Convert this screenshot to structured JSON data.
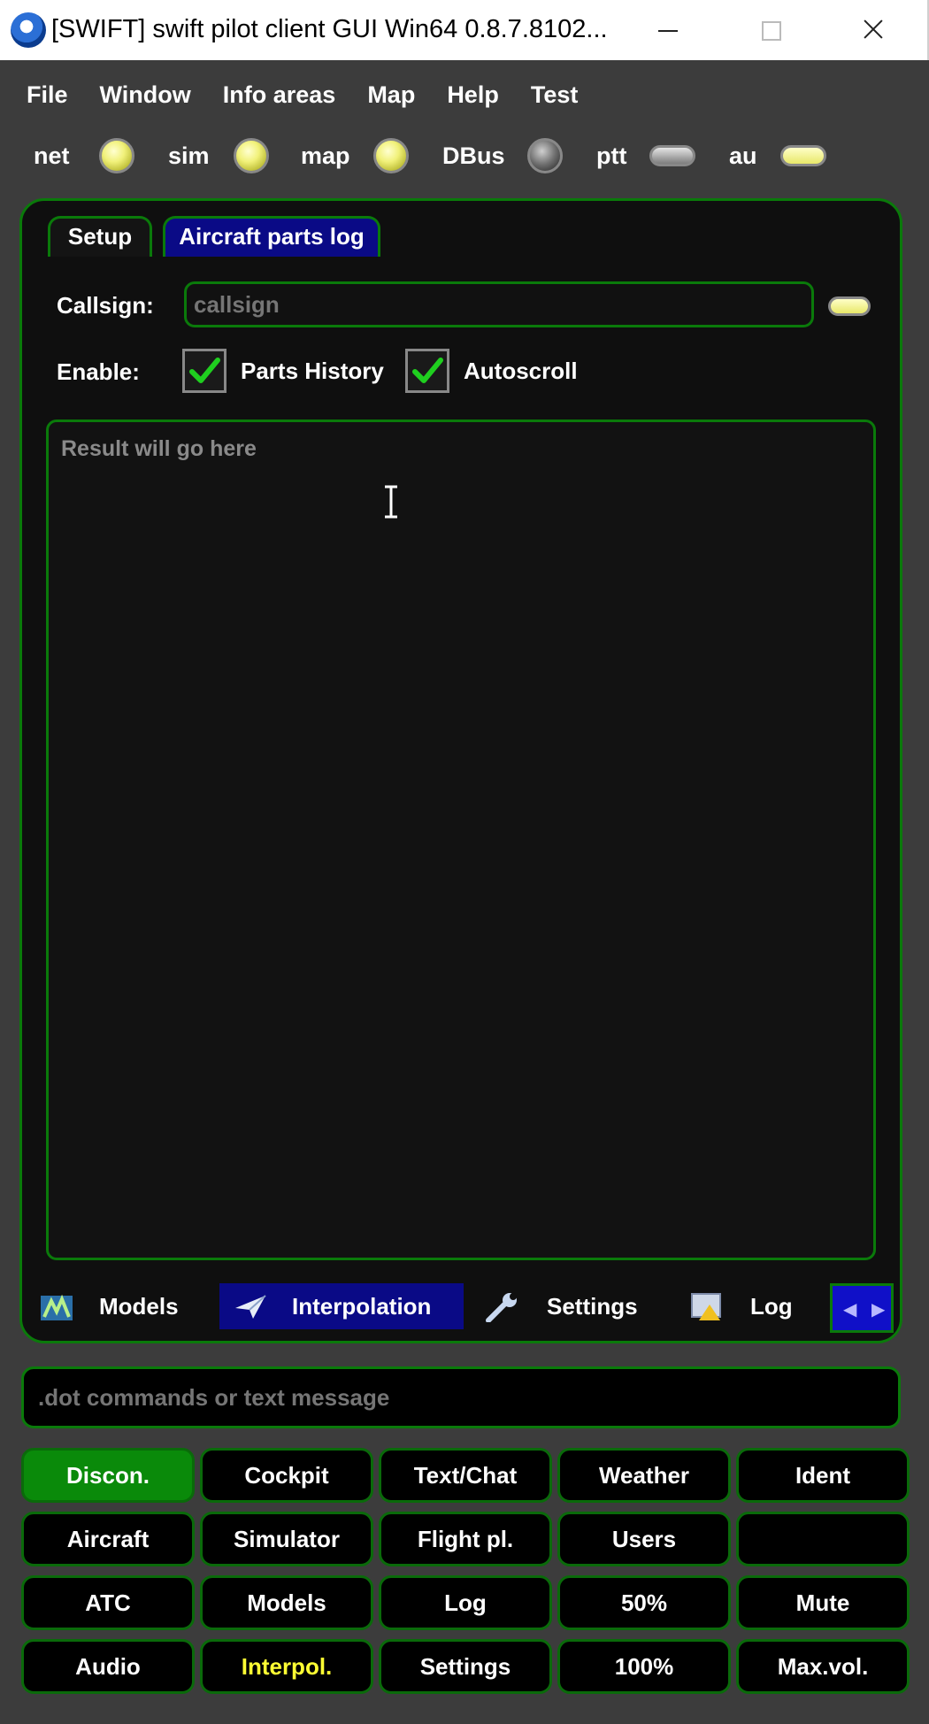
{
  "window": {
    "title": "[SWIFT] swift pilot client GUI Win64 0.8.7.8102..."
  },
  "menu": [
    "File",
    "Window",
    "Info areas",
    "Map",
    "Help",
    "Test"
  ],
  "indicators": {
    "net": "net",
    "sim": "sim",
    "map": "map",
    "dbus": "DBus",
    "ptt": "ptt",
    "au": "au"
  },
  "tabs": {
    "setup": "Setup",
    "parts_log": "Aircraft parts log"
  },
  "form": {
    "callsign_label": "Callsign:",
    "callsign_placeholder": "callsign",
    "enable_label": "Enable:",
    "parts_history": "Parts History",
    "parts_history_checked": true,
    "autoscroll": "Autoscroll",
    "autoscroll_checked": true,
    "result_placeholder": "Result will go here"
  },
  "bottom_tabs": [
    "Models",
    "Interpolation",
    "Settings",
    "Log"
  ],
  "command": {
    "placeholder": ".dot commands or text message"
  },
  "buttons": [
    [
      "Discon.",
      "Cockpit",
      "Text/Chat",
      "Weather",
      "Ident"
    ],
    [
      "Aircraft",
      "Simulator",
      "Flight pl.",
      "Users",
      ""
    ],
    [
      "ATC",
      "Models",
      "Log",
      "50%",
      "Mute"
    ],
    [
      "Audio",
      "Interpol.",
      "Settings",
      "100%",
      "Max.vol."
    ]
  ],
  "colors": {
    "accent_green": "#0a7a0a",
    "active_green": "#0a8a0a",
    "selected_blue": "#0a0a86",
    "highlight_yellow": "#ffff33"
  }
}
